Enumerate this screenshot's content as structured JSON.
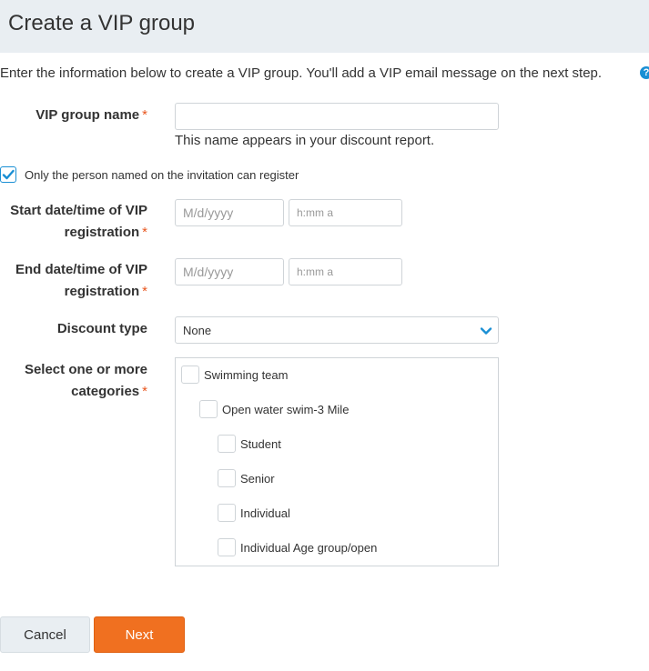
{
  "header": {
    "title": "Create a VIP group"
  },
  "intro": {
    "text": "Enter the information below to create a VIP group. You'll add a VIP email message on the next step.",
    "help_icon": "?"
  },
  "form": {
    "required_mark": "*",
    "vip_group_name": {
      "label": "VIP group name",
      "value": "",
      "hint": "This name appears in your discount report."
    },
    "only_named": {
      "label": "Only the person named on the invitation can register",
      "checked": true
    },
    "start": {
      "label_line1": "Start date/time of VIP",
      "label_line2": "registration",
      "date_placeholder": "M/d/yyyy",
      "time_placeholder": "h:mm a"
    },
    "end": {
      "label_line1": "End date/time of VIP",
      "label_line2": "registration",
      "date_placeholder": "M/d/yyyy",
      "time_placeholder": "h:mm a"
    },
    "discount_type": {
      "label": "Discount type",
      "selected": "None"
    },
    "categories": {
      "label_line1": "Select one or more",
      "label_line2": "categories",
      "items": [
        {
          "label": "Swimming team",
          "level": 0
        },
        {
          "label": "Open water swim-3 Mile",
          "level": 1
        },
        {
          "label": "Student",
          "level": 2
        },
        {
          "label": "Senior",
          "level": 2
        },
        {
          "label": "Individual",
          "level": 2
        },
        {
          "label": "Individual Age group/open",
          "level": 2
        }
      ]
    }
  },
  "buttons": {
    "cancel": "Cancel",
    "next": "Next"
  },
  "colors": {
    "accent": "#1a8fd4",
    "primary_button": "#f07020",
    "required": "#e8561e",
    "header_bg": "#e9eef2"
  }
}
